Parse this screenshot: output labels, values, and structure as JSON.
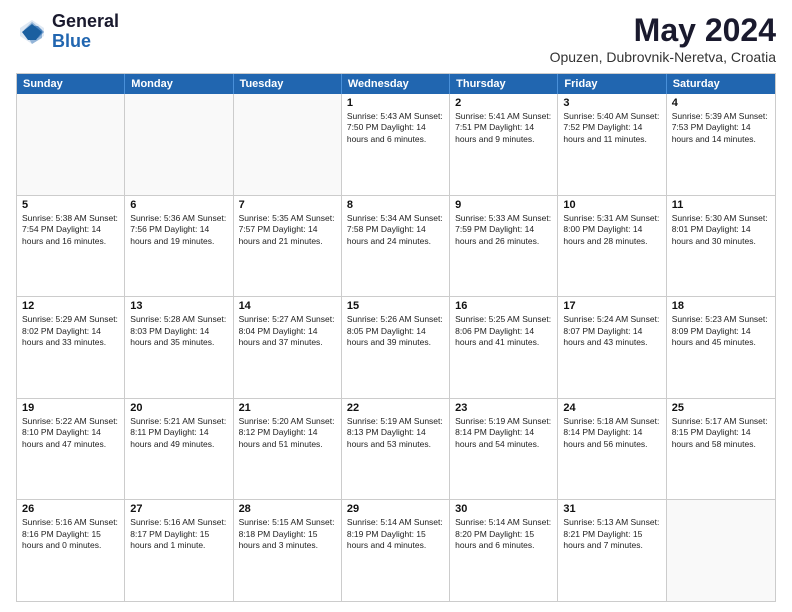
{
  "logo": {
    "general": "General",
    "blue": "Blue"
  },
  "title": "May 2024",
  "location": "Opuzen, Dubrovnik-Neretva, Croatia",
  "headers": [
    "Sunday",
    "Monday",
    "Tuesday",
    "Wednesday",
    "Thursday",
    "Friday",
    "Saturday"
  ],
  "weeks": [
    [
      {
        "day": "",
        "detail": ""
      },
      {
        "day": "",
        "detail": ""
      },
      {
        "day": "",
        "detail": ""
      },
      {
        "day": "1",
        "detail": "Sunrise: 5:43 AM\nSunset: 7:50 PM\nDaylight: 14 hours\nand 6 minutes."
      },
      {
        "day": "2",
        "detail": "Sunrise: 5:41 AM\nSunset: 7:51 PM\nDaylight: 14 hours\nand 9 minutes."
      },
      {
        "day": "3",
        "detail": "Sunrise: 5:40 AM\nSunset: 7:52 PM\nDaylight: 14 hours\nand 11 minutes."
      },
      {
        "day": "4",
        "detail": "Sunrise: 5:39 AM\nSunset: 7:53 PM\nDaylight: 14 hours\nand 14 minutes."
      }
    ],
    [
      {
        "day": "5",
        "detail": "Sunrise: 5:38 AM\nSunset: 7:54 PM\nDaylight: 14 hours\nand 16 minutes."
      },
      {
        "day": "6",
        "detail": "Sunrise: 5:36 AM\nSunset: 7:56 PM\nDaylight: 14 hours\nand 19 minutes."
      },
      {
        "day": "7",
        "detail": "Sunrise: 5:35 AM\nSunset: 7:57 PM\nDaylight: 14 hours\nand 21 minutes."
      },
      {
        "day": "8",
        "detail": "Sunrise: 5:34 AM\nSunset: 7:58 PM\nDaylight: 14 hours\nand 24 minutes."
      },
      {
        "day": "9",
        "detail": "Sunrise: 5:33 AM\nSunset: 7:59 PM\nDaylight: 14 hours\nand 26 minutes."
      },
      {
        "day": "10",
        "detail": "Sunrise: 5:31 AM\nSunset: 8:00 PM\nDaylight: 14 hours\nand 28 minutes."
      },
      {
        "day": "11",
        "detail": "Sunrise: 5:30 AM\nSunset: 8:01 PM\nDaylight: 14 hours\nand 30 minutes."
      }
    ],
    [
      {
        "day": "12",
        "detail": "Sunrise: 5:29 AM\nSunset: 8:02 PM\nDaylight: 14 hours\nand 33 minutes."
      },
      {
        "day": "13",
        "detail": "Sunrise: 5:28 AM\nSunset: 8:03 PM\nDaylight: 14 hours\nand 35 minutes."
      },
      {
        "day": "14",
        "detail": "Sunrise: 5:27 AM\nSunset: 8:04 PM\nDaylight: 14 hours\nand 37 minutes."
      },
      {
        "day": "15",
        "detail": "Sunrise: 5:26 AM\nSunset: 8:05 PM\nDaylight: 14 hours\nand 39 minutes."
      },
      {
        "day": "16",
        "detail": "Sunrise: 5:25 AM\nSunset: 8:06 PM\nDaylight: 14 hours\nand 41 minutes."
      },
      {
        "day": "17",
        "detail": "Sunrise: 5:24 AM\nSunset: 8:07 PM\nDaylight: 14 hours\nand 43 minutes."
      },
      {
        "day": "18",
        "detail": "Sunrise: 5:23 AM\nSunset: 8:09 PM\nDaylight: 14 hours\nand 45 minutes."
      }
    ],
    [
      {
        "day": "19",
        "detail": "Sunrise: 5:22 AM\nSunset: 8:10 PM\nDaylight: 14 hours\nand 47 minutes."
      },
      {
        "day": "20",
        "detail": "Sunrise: 5:21 AM\nSunset: 8:11 PM\nDaylight: 14 hours\nand 49 minutes."
      },
      {
        "day": "21",
        "detail": "Sunrise: 5:20 AM\nSunset: 8:12 PM\nDaylight: 14 hours\nand 51 minutes."
      },
      {
        "day": "22",
        "detail": "Sunrise: 5:19 AM\nSunset: 8:13 PM\nDaylight: 14 hours\nand 53 minutes."
      },
      {
        "day": "23",
        "detail": "Sunrise: 5:19 AM\nSunset: 8:14 PM\nDaylight: 14 hours\nand 54 minutes."
      },
      {
        "day": "24",
        "detail": "Sunrise: 5:18 AM\nSunset: 8:14 PM\nDaylight: 14 hours\nand 56 minutes."
      },
      {
        "day": "25",
        "detail": "Sunrise: 5:17 AM\nSunset: 8:15 PM\nDaylight: 14 hours\nand 58 minutes."
      }
    ],
    [
      {
        "day": "26",
        "detail": "Sunrise: 5:16 AM\nSunset: 8:16 PM\nDaylight: 15 hours\nand 0 minutes."
      },
      {
        "day": "27",
        "detail": "Sunrise: 5:16 AM\nSunset: 8:17 PM\nDaylight: 15 hours\nand 1 minute."
      },
      {
        "day": "28",
        "detail": "Sunrise: 5:15 AM\nSunset: 8:18 PM\nDaylight: 15 hours\nand 3 minutes."
      },
      {
        "day": "29",
        "detail": "Sunrise: 5:14 AM\nSunset: 8:19 PM\nDaylight: 15 hours\nand 4 minutes."
      },
      {
        "day": "30",
        "detail": "Sunrise: 5:14 AM\nSunset: 8:20 PM\nDaylight: 15 hours\nand 6 minutes."
      },
      {
        "day": "31",
        "detail": "Sunrise: 5:13 AM\nSunset: 8:21 PM\nDaylight: 15 hours\nand 7 minutes."
      },
      {
        "day": "",
        "detail": ""
      }
    ]
  ]
}
